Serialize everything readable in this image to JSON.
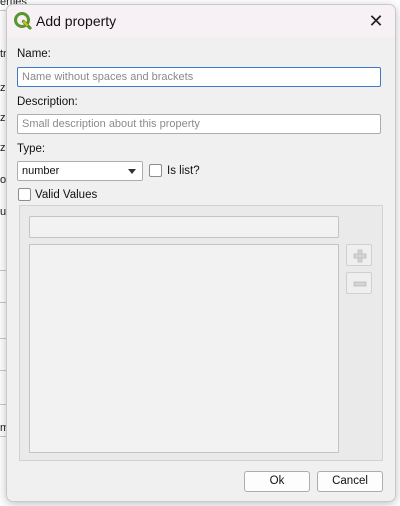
{
  "background": {
    "fragments": [
      "erties",
      "tr",
      "z",
      "z",
      "z",
      "o",
      "ue",
      "m"
    ]
  },
  "dialog": {
    "title": "Add property",
    "app_icon": "qgis-icon",
    "close_label": "✕",
    "name": {
      "label": "Name:",
      "value": "",
      "placeholder": "Name without spaces and brackets"
    },
    "description": {
      "label": "Description:",
      "value": "",
      "placeholder": "Small description about this property"
    },
    "type": {
      "label": "Type:",
      "selected": "number"
    },
    "is_list": {
      "label": "Is list?",
      "checked": false
    },
    "valid_values": {
      "label": "Valid Values",
      "checked": false,
      "enabled": false,
      "add_icon": "plus-icon",
      "remove_icon": "minus-icon"
    },
    "buttons": {
      "ok": "Ok",
      "cancel": "Cancel"
    }
  },
  "colors": {
    "focus_border": "#3c79c9",
    "titlebar": "#f7f0f4",
    "dialog_bg": "#f0f0f0",
    "qgis_green": "#589632",
    "qgis_yellow": "#eeb40a"
  }
}
